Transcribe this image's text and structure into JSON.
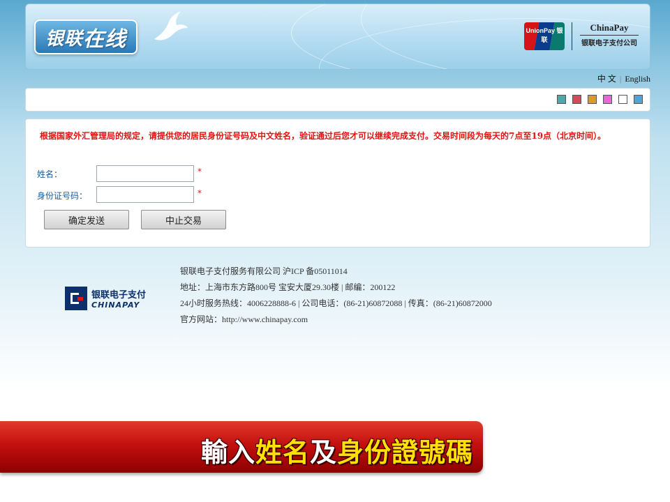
{
  "header": {
    "logo_part1": "银联",
    "logo_part2": "在线",
    "unionpay_text": "UnionPay 银联",
    "chinapay_en": "ChinaPay",
    "chinapay_cn": "银联电子支付公司"
  },
  "lang": {
    "zh": "中 文",
    "sep": "|",
    "en": "English"
  },
  "swatches": [
    "#4fa8a8",
    "#d14b5a",
    "#d99a2e",
    "#e36ad1",
    "#ffffff",
    "#4fa6d6"
  ],
  "form": {
    "notice": "根据国家外汇管理局的规定，请提供您的居民身份证号码及中文姓名，验证通过后您才可以继续完成支付。交易时间段为每天的7点至19点（北京时间）。",
    "name_label": "姓名：",
    "id_label": "身份证号码：",
    "required": "*",
    "submit_label": "确定发送",
    "cancel_label": "中止交易"
  },
  "footer": {
    "logo_cn": "银联电子支付",
    "logo_en": "CHINAPAY",
    "lines": [
      "银联电子支付服务有限公司 沪ICP 备05011014",
      "地址：上海市东方路800号 宝安大厦29.30楼 | 邮编：200122",
      "24小时服务热线：4006228888-6 | 公司电话：(86-21)60872088 | 传真：(86-21)60872000",
      "官方网站：http://www.chinapay.com"
    ]
  },
  "banner": {
    "part1": "輸入",
    "part2": "姓名",
    "part3": "及",
    "part4": "身份證號碼"
  }
}
